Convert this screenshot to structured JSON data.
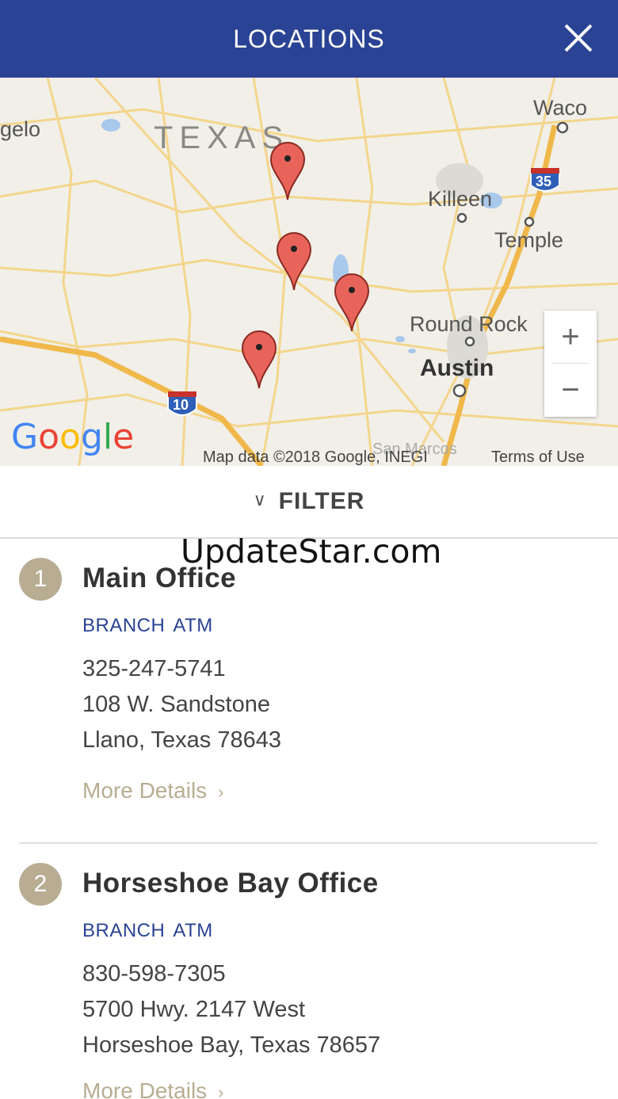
{
  "header": {
    "title": "LOCATIONS",
    "close_icon": "close-icon"
  },
  "map": {
    "labels": {
      "angelo": "gelo",
      "texas": "TEXAS",
      "waco": "Waco",
      "killeen": "Killeen",
      "temple": "Temple",
      "round_rock": "Round Rock",
      "austin": "Austin",
      "san_marcos": "San Marcos",
      "i35": "35",
      "i10": "10"
    },
    "zoom_in": "+",
    "zoom_out": "−",
    "google": [
      "G",
      "o",
      "o",
      "g",
      "l",
      "e"
    ],
    "attribution": "Map data ©2018 Google, INEGI",
    "terms": "Terms of Use",
    "pin_color": "#e8645a"
  },
  "filter": {
    "label": "FILTER",
    "icon": "chevron-down-icon"
  },
  "watermark": "UpdateStar.com",
  "locations": [
    {
      "number": "1",
      "name": "Main Office",
      "tags": [
        "BRANCH",
        "ATM"
      ],
      "phone": "325-247-5741",
      "address1": "108 W. Sandstone",
      "address2": "Llano, Texas 78643",
      "more": "More Details"
    },
    {
      "number": "2",
      "name": "Horseshoe Bay Office",
      "tags": [
        "BRANCH",
        "ATM"
      ],
      "phone": "830-598-7305",
      "address1": "5700 Hwy. 2147 West",
      "address2": "Horseshoe Bay, Texas 78657",
      "more": "More Details"
    }
  ],
  "colors": {
    "brand": "#2a4394",
    "accent": "#b8ad92"
  }
}
